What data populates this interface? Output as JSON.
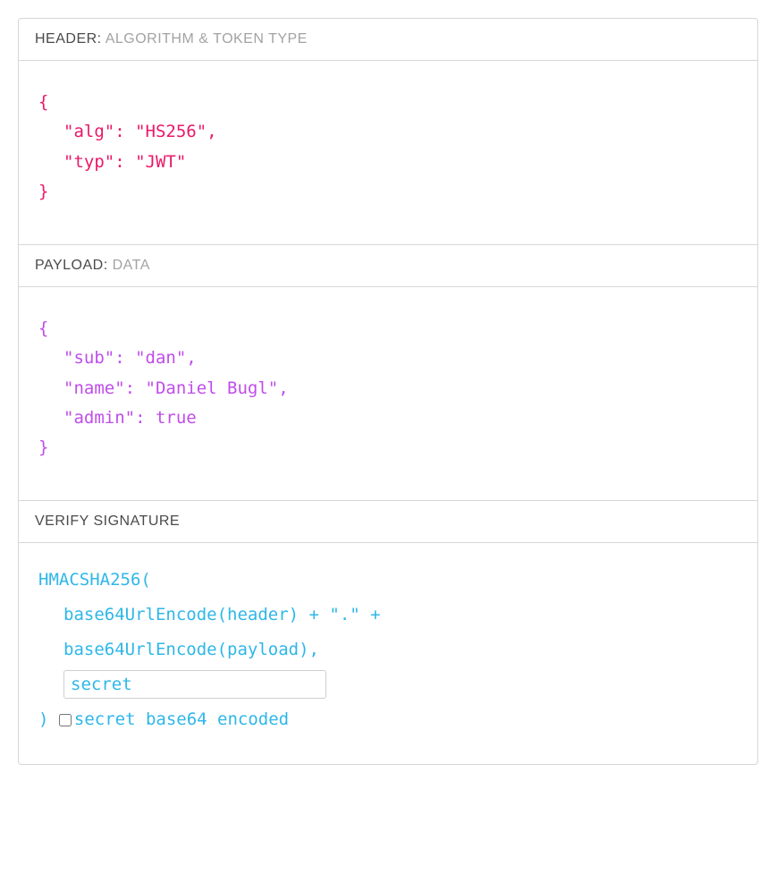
{
  "sections": {
    "header": {
      "title_dark": "HEADER:",
      "title_light": "ALGORITHM & TOKEN TYPE",
      "code": {
        "open": "{",
        "line1": "\"alg\": \"HS256\",",
        "line2": "\"typ\": \"JWT\"",
        "close": "}"
      }
    },
    "payload": {
      "title_dark": "PAYLOAD:",
      "title_light": "DATA",
      "code": {
        "open": "{",
        "line1": "\"sub\": \"dan\",",
        "line2": "\"name\": \"Daniel Bugl\",",
        "line3": "\"admin\": true",
        "close": "}"
      }
    },
    "signature": {
      "title_dark": "VERIFY SIGNATURE",
      "code": {
        "line1": "HMACSHA256(",
        "line2": "base64UrlEncode(header) + \".\" +",
        "line3": "base64UrlEncode(payload),",
        "secret_value": "secret",
        "close_paren": ") ",
        "checkbox_label": "secret base64 encoded"
      }
    }
  }
}
